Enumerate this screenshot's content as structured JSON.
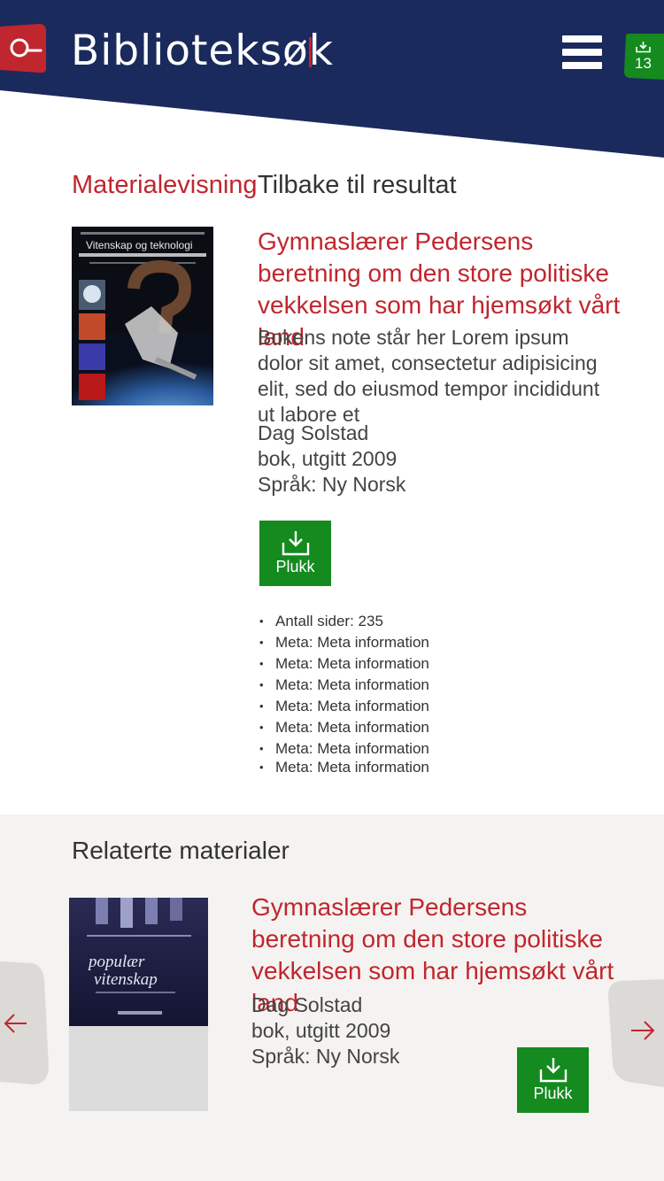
{
  "header": {
    "app_title": "Biblioteksøk",
    "picked_count": "13",
    "colors": {
      "navy": "#1b2a5c",
      "accent_red": "#c0262e",
      "green": "#148a1f"
    }
  },
  "breadcrumb": {
    "current": "Materialevisning",
    "back_link": "Tilbake til resultat"
  },
  "material": {
    "cover_icon": "book-cover-vitenskap-og-teknologi",
    "title": "Gymnaslærer Pedersens beretning om den store politiske vekkelsen som har hjemsøkt vårt land",
    "note": "Bokens note står her Lorem ipsum dolor sit amet, consectetur adipisicing elit, sed do eiusmod tempor incididunt ut labore et",
    "author": "Dag Solstad",
    "type_year": "bok, utgitt 2009",
    "language": "Språk: Ny Norsk",
    "pick_label": "Plukk",
    "meta": [
      "Antall sider: 235",
      "Meta: Meta information",
      "Meta: Meta information",
      "Meta: Meta information",
      "Meta: Meta information",
      "Meta: Meta information",
      "Meta: Meta information",
      "Meta: Meta information"
    ]
  },
  "related": {
    "heading": "Relaterte materialer",
    "item": {
      "cover_icon": "book-cover-populaer-vitenskap",
      "title": "Gymnaslærer Pedersens beretning om den store politiske vekkelsen som har hjemsøkt vårt land",
      "author": "Dag Solstad",
      "type_year": "bok, utgitt 2009",
      "language": "Språk: Ny Norsk",
      "pick_label": "Plukk"
    },
    "prev_icon": "arrow-left-icon",
    "next_icon": "arrow-right-icon"
  }
}
